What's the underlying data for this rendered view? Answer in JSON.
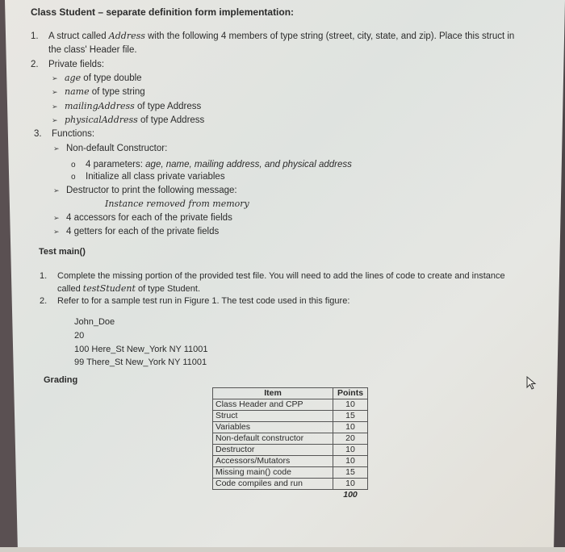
{
  "title": "Class Student – separate definition form implementation:",
  "requirements": [
    {
      "num": "1.",
      "line1_pre": "A struct called ",
      "line1_em": "Address",
      "line1_post": " with the following 4 members of type string (street, city, state, and zip). Place this struct in",
      "line2": "the class' Header file."
    },
    {
      "num": "2.",
      "label": "Private fields:",
      "fields": [
        {
          "name": "age",
          "rest": " of type double"
        },
        {
          "name": "name",
          "rest": " of type string"
        },
        {
          "name": "mailingAddress",
          "rest": " of type Address"
        },
        {
          "name": "physicalAddress",
          "rest": " of type Address"
        }
      ]
    },
    {
      "num": "3.",
      "label": "Functions:",
      "constructor": {
        "label": "Non-default Constructor:",
        "params_pre": "4 parameters: ",
        "params_em": "age, name, mailing address, and physical address",
        "init": "Initialize all class private variables"
      },
      "destructor": {
        "label": "Destructor to print the following message:",
        "message": "Instance removed from memory"
      },
      "accessors": "4 accessors for each of the private fields",
      "getters": "4 getters for each of the private fields"
    }
  ],
  "test_main": {
    "heading": "Test main()",
    "items": [
      {
        "num": "1.",
        "line1": "Complete the missing portion of the provided test file. You will need to add the lines of code to create and instance",
        "line2_pre": "called ",
        "line2_em": "testStudent",
        "line2_post": " of type Student."
      },
      {
        "num": "2.",
        "line1": "Refer to for a sample test run in Figure 1. The test code used in this figure:"
      }
    ],
    "sample_lines": [
      "John_Doe",
      "20",
      "100 Here_St New_York NY 11001",
      "99 There_St New_York NY 11001"
    ]
  },
  "grading": {
    "heading": "Grading",
    "columns": [
      "Item",
      "Points"
    ],
    "rows": [
      {
        "item": "Class Header and CPP",
        "points": "10"
      },
      {
        "item": "Struct",
        "points": "15"
      },
      {
        "item": "Variables",
        "points": "10"
      },
      {
        "item": "Non-default constructor",
        "points": "20"
      },
      {
        "item": "Destructor",
        "points": "10"
      },
      {
        "item": "Accessors/Mutators",
        "points": "10"
      },
      {
        "item": "Missing main() code",
        "points": "15"
      },
      {
        "item": "Code compiles and run",
        "points": "10"
      }
    ],
    "total": "100"
  },
  "icons": {
    "bullet_arrow": "➢",
    "bullet_circle": "o",
    "cursor": "mouse-pointer-icon"
  }
}
